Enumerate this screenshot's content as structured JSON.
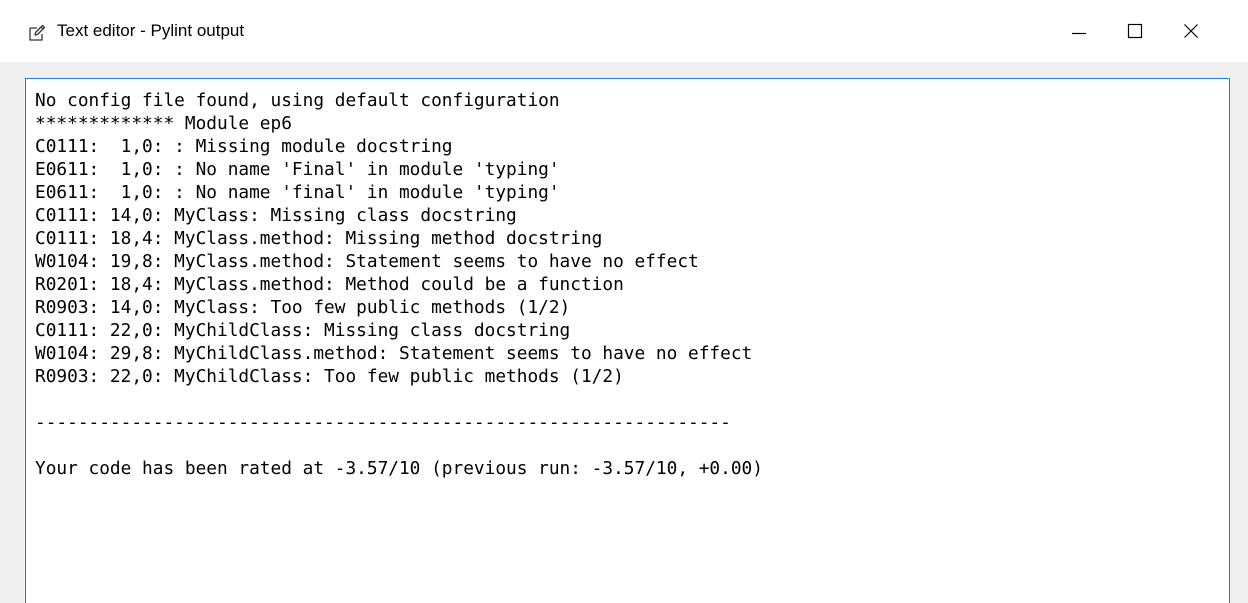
{
  "window": {
    "title": "Text editor - Pylint output",
    "icon": "edit-icon",
    "controls": [
      "minimize-icon",
      "maximize-icon",
      "close-icon"
    ]
  },
  "editor": {
    "lines": [
      "No config file found, using default configuration",
      "************* Module ep6",
      "C0111:  1,0: : Missing module docstring",
      "E0611:  1,0: : No name 'Final' in module 'typing'",
      "E0611:  1,0: : No name 'final' in module 'typing'",
      "C0111: 14,0: MyClass: Missing class docstring",
      "C0111: 18,4: MyClass.method: Missing method docstring",
      "W0104: 19,8: MyClass.method: Statement seems to have no effect",
      "R0201: 18,4: MyClass.method: Method could be a function",
      "R0903: 14,0: MyClass: Too few public methods (1/2)",
      "C0111: 22,0: MyChildClass: Missing class docstring",
      "W0104: 29,8: MyChildClass.method: Statement seems to have no effect",
      "R0903: 22,0: MyChildClass: Too few public methods (1/2)",
      "",
      "-----------------------------------------------------------------",
      "",
      "Your code has been rated at -3.57/10 (previous run: -3.57/10, +0.00)"
    ]
  },
  "colors": {
    "border_focus": "#1e7fd6",
    "frame_background": "#f0f0f0"
  }
}
